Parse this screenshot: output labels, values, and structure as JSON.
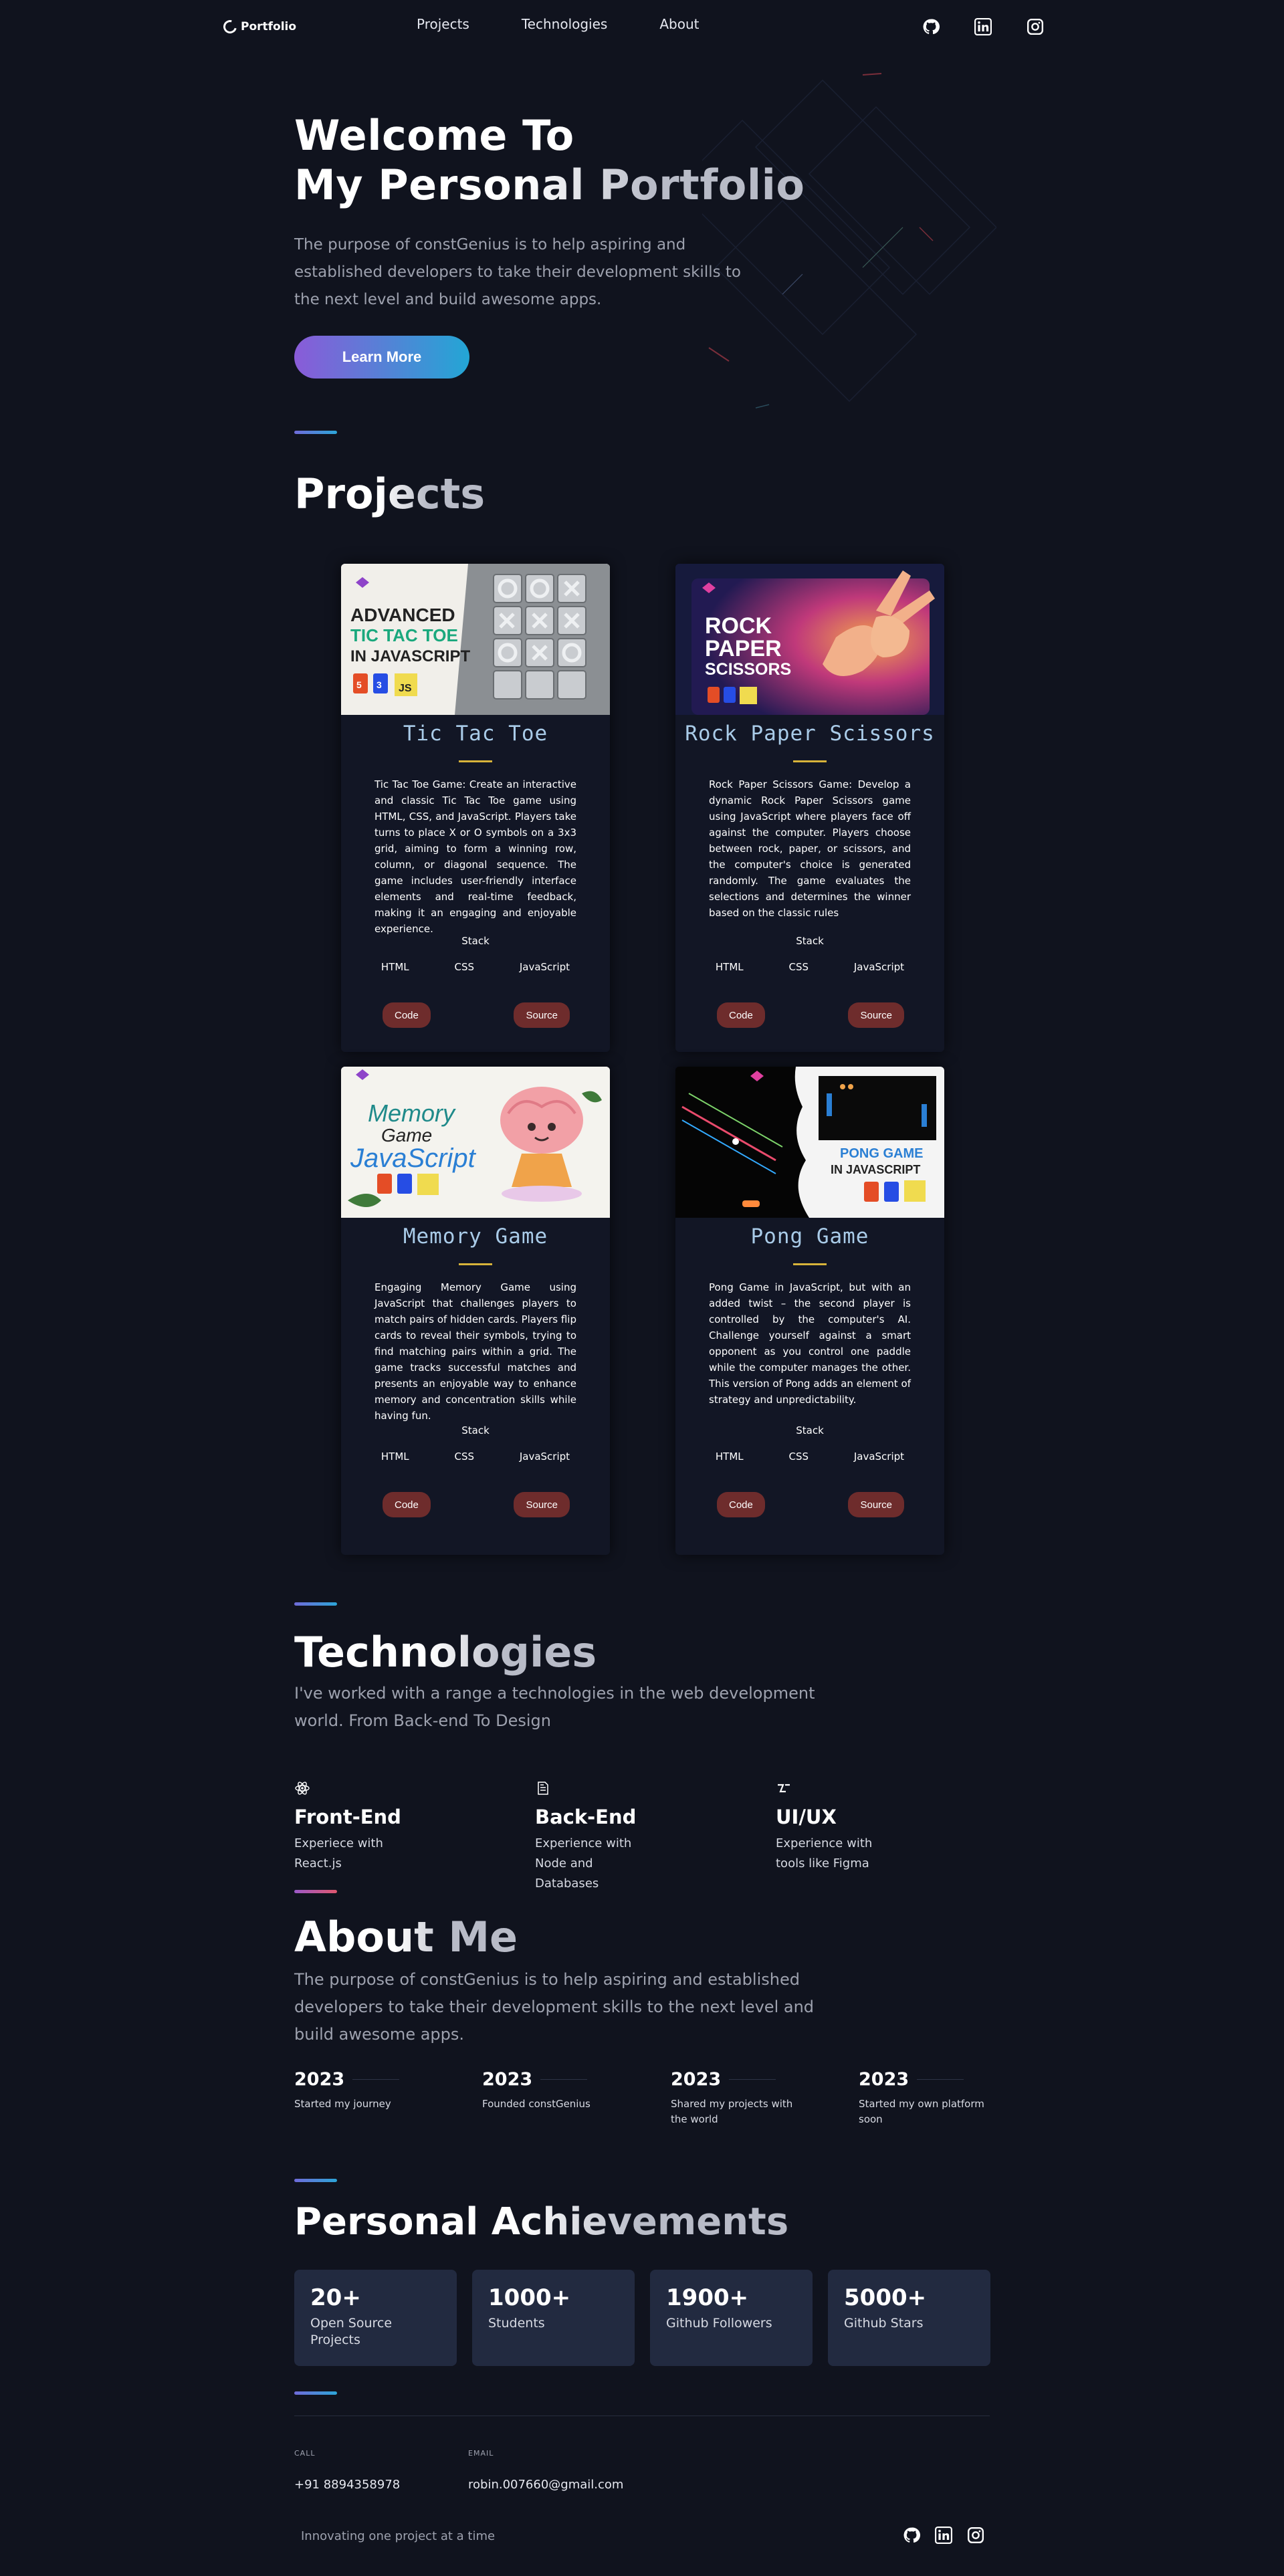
{
  "nav": {
    "logo_text": "Portfolio",
    "links": [
      "Projects",
      "Technologies",
      "About"
    ],
    "icons": [
      "github-icon",
      "linkedin-icon",
      "instagram-icon"
    ]
  },
  "hero": {
    "title_line1": "Welcome To",
    "title_line2": "My Personal Portfolio",
    "description": "The purpose of constGenius is to help aspiring and established developers to take their development skills to the next level and build awesome apps.",
    "cta_label": "Learn More"
  },
  "projects": {
    "heading": "Projects",
    "items": [
      {
        "title": "Tic Tac Toe",
        "image_text": [
          "ADVANCED",
          "TIC TAC TOE",
          "IN JAVASCRIPT"
        ],
        "description": "Tic Tac Toe Game: Create an interactive and classic Tic Tac Toe game using HTML, CSS, and JavaScript. Players take turns to place X or O symbols on a 3x3 grid, aiming to form a winning row, column, or diagonal sequence. The game includes user-friendly interface elements and real-time feedback, making it an engaging and enjoyable experience.",
        "stack_label": "Stack",
        "techs": [
          "HTML",
          "CSS",
          "JavaScript"
        ],
        "code_label": "Code",
        "source_label": "Source"
      },
      {
        "title": "Rock Paper Scissors",
        "image_text": [
          "ROCK",
          "PAPER",
          "SCISSORS"
        ],
        "description": "Rock Paper Scissors Game: Develop a dynamic Rock Paper Scissors game using JavaScript where players face off against the computer. Players choose between rock, paper, or scissors, and the computer's choice is generated randomly. The game evaluates the selections and determines the winner based on the classic rules",
        "stack_label": "Stack",
        "techs": [
          "HTML",
          "CSS",
          "JavaScript"
        ],
        "code_label": "Code",
        "source_label": "Source"
      },
      {
        "title": "Memory Game",
        "image_text": [
          "Memory",
          "Game",
          "JavaScript"
        ],
        "description": "Engaging Memory Game using JavaScript that challenges players to match pairs of hidden cards. Players flip cards to reveal their symbols, trying to find matching pairs within a grid. The game tracks successful matches and presents an enjoyable way to enhance memory and concentration skills while having fun.",
        "stack_label": "Stack",
        "techs": [
          "HTML",
          "CSS",
          "JavaScript"
        ],
        "code_label": "Code",
        "source_label": "Source"
      },
      {
        "title": "Pong Game",
        "image_text": [
          "PONG GAME",
          "IN JAVASCRIPT"
        ],
        "description": "Pong Game in JavaScript, but with an added twist – the second player is controlled by the computer's AI. Challenge yourself against a smart opponent as you control one paddle while the computer manages the other. This version of Pong adds an element of strategy and unpredictability.",
        "stack_label": "Stack",
        "techs": [
          "HTML",
          "CSS",
          "JavaScript"
        ],
        "code_label": "Code",
        "source_label": "Source"
      }
    ]
  },
  "technologies": {
    "heading": "Technologies",
    "description": "I've worked with a range a technologies in the web development world. From Back-end To Design",
    "items": [
      {
        "icon": "react-icon",
        "title": "Front-End",
        "text": "Experiece with React.js"
      },
      {
        "icon": "database-icon",
        "title": "Back-End",
        "text": "Experience with Node and Databases"
      },
      {
        "icon": "figma-icon",
        "title": "UI/UX",
        "text": "Experience with tools like Figma"
      }
    ]
  },
  "about": {
    "heading": "About Me",
    "description": "The purpose of constGenius is to help aspiring and established developers to take their development skills to the next level and build awesome apps.",
    "timeline": [
      {
        "year": "2023",
        "text": "Started my journey"
      },
      {
        "year": "2023",
        "text": "Founded constGenius"
      },
      {
        "year": "2023",
        "text": "Shared my projects with the world"
      },
      {
        "year": "2023",
        "text": "Started my own platform soon"
      }
    ]
  },
  "achievements": {
    "heading": "Personal Achievements",
    "items": [
      {
        "number": "20+",
        "label": "Open Source Projects"
      },
      {
        "number": "1000+",
        "label": "Students"
      },
      {
        "number": "1900+",
        "label": "Github Followers"
      },
      {
        "number": "5000+",
        "label": "Github Stars"
      }
    ]
  },
  "footer": {
    "call_label": "CALL",
    "call_value": "+91 8894358978",
    "email_label": "EMAIL",
    "email_value": "robin.007660@gmail.com",
    "tagline": "Innovating one project at a time"
  },
  "colors": {
    "background": "#10131e",
    "accent_gradient_start": "#8a5bd8",
    "accent_gradient_end": "#23a6d5",
    "card_title": "#a9cbe8",
    "button_red": "#6e2c2c",
    "achievement_card": "#222a40"
  }
}
